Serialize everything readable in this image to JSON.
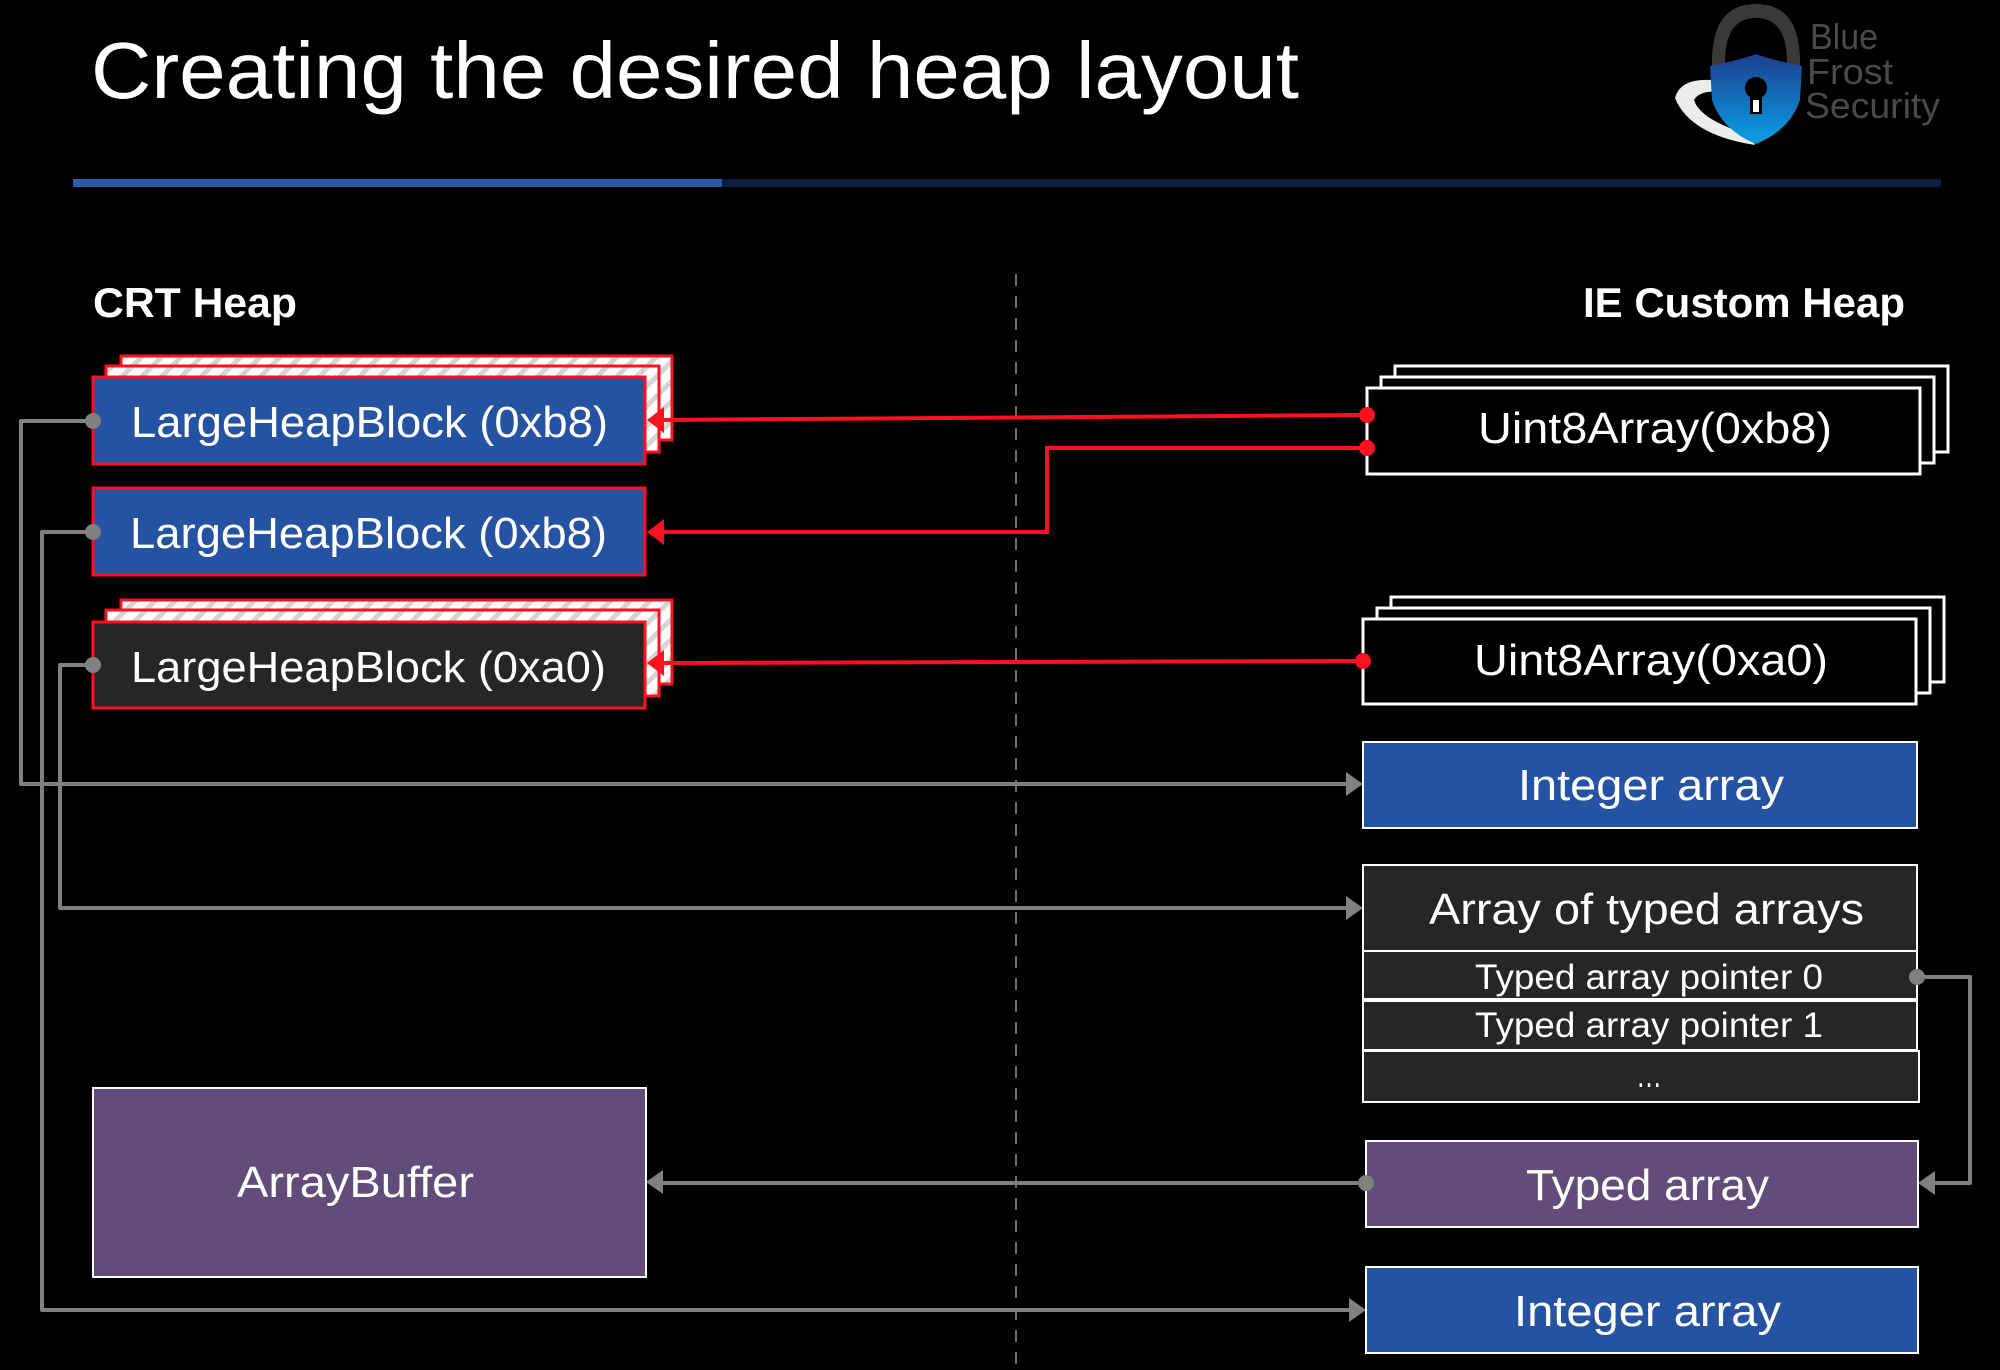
{
  "slide": {
    "title": "Creating the desired heap layout",
    "logo": {
      "name": "Blue Frost Security",
      "lines": [
        "Blue",
        "Frost",
        "Security"
      ],
      "icon": "padlock-shield-icon"
    }
  },
  "colors": {
    "background": "#000000",
    "accent_blue": "#2652A2",
    "header_rule_blue": "#2C5AA8",
    "header_rule_navy": "#0F1E3C",
    "dark_box": "#262626",
    "purple_box": "#624C7A",
    "red_pointer": "#FF1020",
    "gray_pointer": "#808080",
    "divider": "#6E6E6E"
  },
  "diagram": {
    "left_heap": {
      "label": "CRT Heap",
      "blocks": [
        {
          "label": "LargeHeapBlock (0xb8)",
          "style": "blue",
          "stacked": true
        },
        {
          "label": "LargeHeapBlock (0xb8)",
          "style": "blue",
          "stacked": false
        },
        {
          "label": "LargeHeapBlock (0xa0)",
          "style": "dark",
          "stacked": true
        },
        {
          "label": "ArrayBuffer",
          "style": "purple",
          "stacked": false
        }
      ]
    },
    "right_heap": {
      "label": "IE Custom Heap",
      "blocks": [
        {
          "label": "Uint8Array(0xb8)",
          "style": "outline",
          "stacked": true
        },
        {
          "label": "Uint8Array(0xa0)",
          "style": "outline",
          "stacked": true
        },
        {
          "label": "Integer array",
          "style": "blue",
          "stacked": false
        },
        {
          "label": "Array of typed arrays",
          "style": "dark",
          "rows": [
            "Typed array pointer 0",
            "Typed array pointer 1",
            "…"
          ]
        },
        {
          "label": "Typed array",
          "style": "purple",
          "stacked": false
        },
        {
          "label": "Integer array",
          "style": "blue",
          "stacked": false
        }
      ]
    },
    "connections": [
      {
        "from": "Uint8Array(0xb8)",
        "to": "LargeHeapBlock (0xb8) #1",
        "color": "red"
      },
      {
        "from": "Uint8Array(0xb8)",
        "to": "LargeHeapBlock (0xb8) #2",
        "color": "red"
      },
      {
        "from": "Uint8Array(0xa0)",
        "to": "LargeHeapBlock (0xa0)",
        "color": "red"
      },
      {
        "from": "LargeHeapBlock (0xb8) #1",
        "to": "Integer array #1",
        "color": "gray"
      },
      {
        "from": "LargeHeapBlock (0xb8) #2",
        "to": "Integer array #2",
        "color": "gray"
      },
      {
        "from": "LargeHeapBlock (0xa0)",
        "to": "Array of typed arrays",
        "color": "gray"
      },
      {
        "from": "Typed array pointer 0",
        "to": "Typed array",
        "color": "gray"
      },
      {
        "from": "Typed array",
        "to": "ArrayBuffer",
        "color": "gray"
      }
    ]
  }
}
